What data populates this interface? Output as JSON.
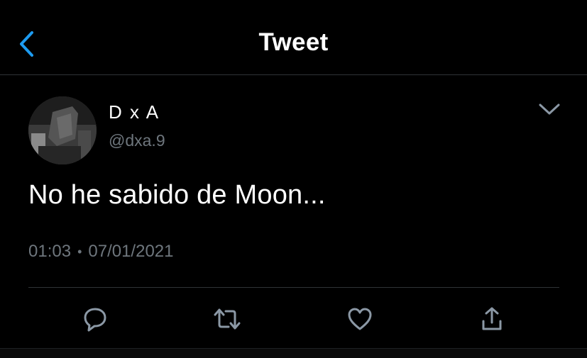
{
  "header": {
    "title": "Tweet",
    "back_icon": "chevron-left-icon",
    "back_color": "#1d9bf0"
  },
  "tweet": {
    "display_name": "D x A",
    "handle": "@dxa.9",
    "text": "No he sabido de Moon...",
    "time": "01:03",
    "separator": "•",
    "date": "07/01/2021",
    "menu_icon": "chevron-down-icon"
  },
  "actions": [
    {
      "name": "reply",
      "icon": "reply-icon"
    },
    {
      "name": "retweet",
      "icon": "retweet-icon"
    },
    {
      "name": "like",
      "icon": "heart-icon"
    },
    {
      "name": "share",
      "icon": "share-icon"
    }
  ],
  "colors": {
    "background": "#000000",
    "text": "#ffffff",
    "secondary_text": "#6e767d",
    "divider": "#2f3336",
    "icon": "#8b98a5"
  }
}
